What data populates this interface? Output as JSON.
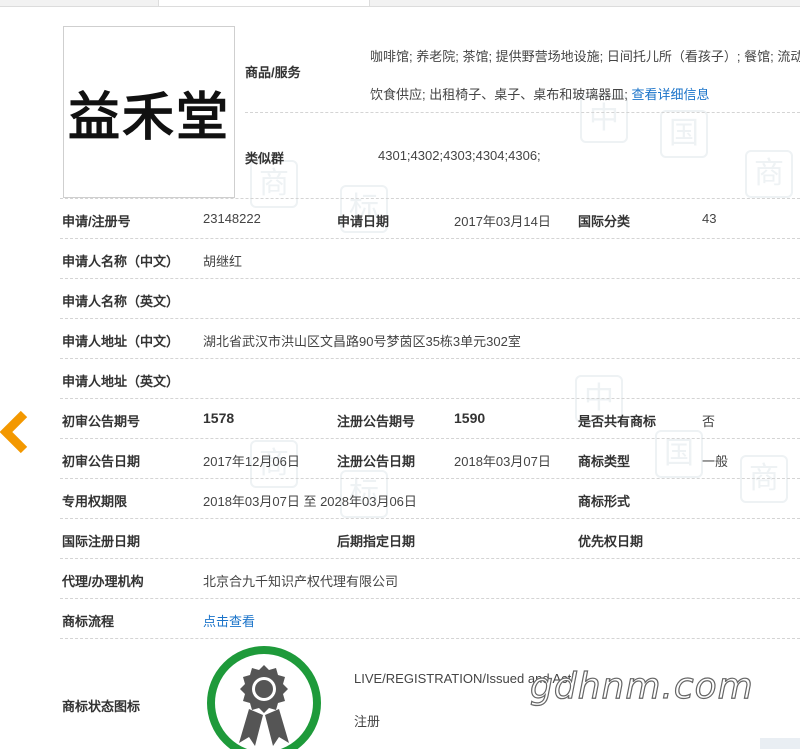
{
  "logo": {
    "text": "益禾堂"
  },
  "goods": {
    "label": "商品/服务",
    "text": "咖啡馆; 养老院; 茶馆; 提供野营场地设施; 日间托儿所（看孩子）; 餐馆; 流动饮食供应; 出租椅子、桌子、桌布和玻璃器皿; ",
    "detail_link": "查看详细信息"
  },
  "similar": {
    "label": "类似群",
    "value": "4301;4302;4303;4304;4306;"
  },
  "rows": {
    "reg_no_label": "申请/注册号",
    "reg_no": "23148222",
    "app_date_label": "申请日期",
    "app_date": "2017年03月14日",
    "intl_class_label": "国际分类",
    "intl_class": "43",
    "applicant_cn_label": "申请人名称（中文）",
    "applicant_cn": "胡继红",
    "applicant_en_label": "申请人名称（英文）",
    "applicant_en": "",
    "address_cn_label": "申请人地址（中文）",
    "address_cn": "湖北省武汉市洪山区文昌路90号梦茵区35栋3单元302室",
    "address_en_label": "申请人地址（英文）",
    "address_en": "",
    "prelim_no_label": "初审公告期号",
    "prelim_no": "1578",
    "reg_pub_no_label": "注册公告期号",
    "reg_pub_no": "1590",
    "shared_label": "是否共有商标",
    "shared": "否",
    "prelim_date_label": "初审公告日期",
    "prelim_date": "2017年12月06日",
    "reg_pub_date_label": "注册公告日期",
    "reg_pub_date": "2018年03月07日",
    "tm_type_label": "商标类型",
    "tm_type": "一般",
    "exclusive_label": "专用权期限",
    "exclusive": "2018年03月07日 至 2028年03月06日",
    "tm_form_label": "商标形式",
    "tm_form": "",
    "intl_reg_date_label": "国际注册日期",
    "intl_reg_date": "",
    "later_date_label": "后期指定日期",
    "later_date": "",
    "priority_label": "优先权日期",
    "priority": "",
    "agent_label": "代理/办理机构",
    "agent": "北京合九千知识产权代理有限公司",
    "process_label": "商标流程",
    "process_link": "点击查看",
    "status_icon_label": "商标状态图标",
    "status_en": "LIVE/REGISTRATION/Issued and Acti",
    "status_cn": "注册"
  },
  "watermark": "gdhnm.com",
  "colors": {
    "accent_orange": "#f39800",
    "link_blue": "#1a73c9",
    "badge_green": "#1e9a3a",
    "badge_gray": "#555555"
  }
}
